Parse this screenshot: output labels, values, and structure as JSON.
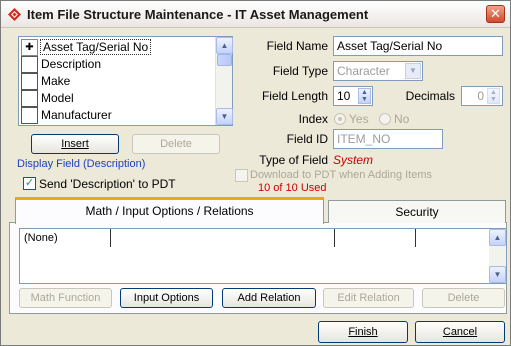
{
  "window": {
    "title": "Item File Structure Maintenance - IT Asset Management",
    "close_glyph": "✕"
  },
  "field_list": {
    "items": [
      {
        "checked": true,
        "label": "Asset Tag/Serial No"
      },
      {
        "checked": false,
        "label": "Description"
      },
      {
        "checked": false,
        "label": "Make"
      },
      {
        "checked": false,
        "label": "Model"
      },
      {
        "checked": false,
        "label": "Manufacturer"
      }
    ],
    "check_glyph": "✚"
  },
  "buttons": {
    "insert": "Insert",
    "delete": "Delete",
    "math_function": "Math Function",
    "input_options": "Input Options",
    "add_relation": "Add Relation",
    "edit_relation": "Edit Relation",
    "delete_relation": "Delete",
    "finish": "Finish",
    "cancel": "Cancel"
  },
  "display_field": {
    "label": "Display Field (Description)",
    "send_desc_label": "Send 'Description' to PDT",
    "send_desc_checked": true
  },
  "form": {
    "field_name_label": "Field Name",
    "field_name_value": "Asset Tag/Serial No",
    "field_type_label": "Field Type",
    "field_type_value": "Character",
    "field_length_label": "Field Length",
    "field_length_value": "10",
    "decimals_label": "Decimals",
    "decimals_value": "0",
    "index_label": "Index",
    "index_yes": "Yes",
    "index_no": "No",
    "field_id_label": "Field ID",
    "field_id_value": "ITEM_NO",
    "type_of_field_label": "Type of Field",
    "type_of_field_value": "System",
    "download_label": "Download to PDT when Adding Items",
    "used_count": "10 of 10 Used"
  },
  "tabs": [
    {
      "label": "Math / Input Options / Relations",
      "active": true
    },
    {
      "label": "Security",
      "active": false
    }
  ],
  "grid": {
    "first_cell": "(None)"
  },
  "colors": {
    "accent_red": "#cc0000",
    "link_blue": "#1f3fbf",
    "tab_highlight": "#f3a31d"
  }
}
